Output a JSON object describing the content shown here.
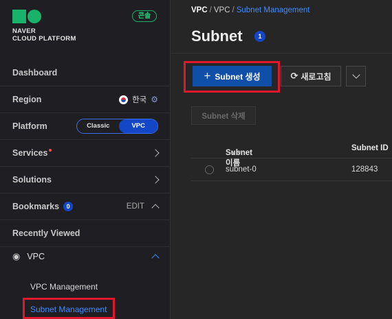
{
  "logo": {
    "line1": "NAVER",
    "line2": "CLOUD PLATFORM"
  },
  "console_badge": "콘솔",
  "sidebar": {
    "dashboard": "Dashboard",
    "region": {
      "label": "Region",
      "value": "한국"
    },
    "platform": {
      "label": "Platform",
      "options": [
        "Classic",
        "VPC"
      ],
      "selected": "VPC"
    },
    "services": "Services",
    "solutions": "Solutions",
    "bookmarks": {
      "label": "Bookmarks",
      "count": "0",
      "edit": "EDIT"
    },
    "recently_viewed": "Recently Viewed",
    "vpc": {
      "label": "VPC",
      "items": [
        "VPC Management",
        "Subnet Management"
      ],
      "active": "Subnet Management"
    }
  },
  "breadcrumb": {
    "root": "VPC",
    "sep": "/",
    "mid": "VPC",
    "current": "Subnet Management"
  },
  "page": {
    "title": "Subnet",
    "count": "1"
  },
  "toolbar": {
    "create_label": "Subnet 생성",
    "refresh_label": "새로고침",
    "delete_label": "Subnet 삭제"
  },
  "table": {
    "columns": [
      "Subnet 이름",
      "Subnet ID"
    ],
    "rows": [
      {
        "name": "subnet-0",
        "id": "128843"
      }
    ]
  },
  "colors": {
    "accent": "#1446c8",
    "link": "#3f8cff",
    "brand": "#18b26b",
    "highlight": "#e0182d"
  }
}
